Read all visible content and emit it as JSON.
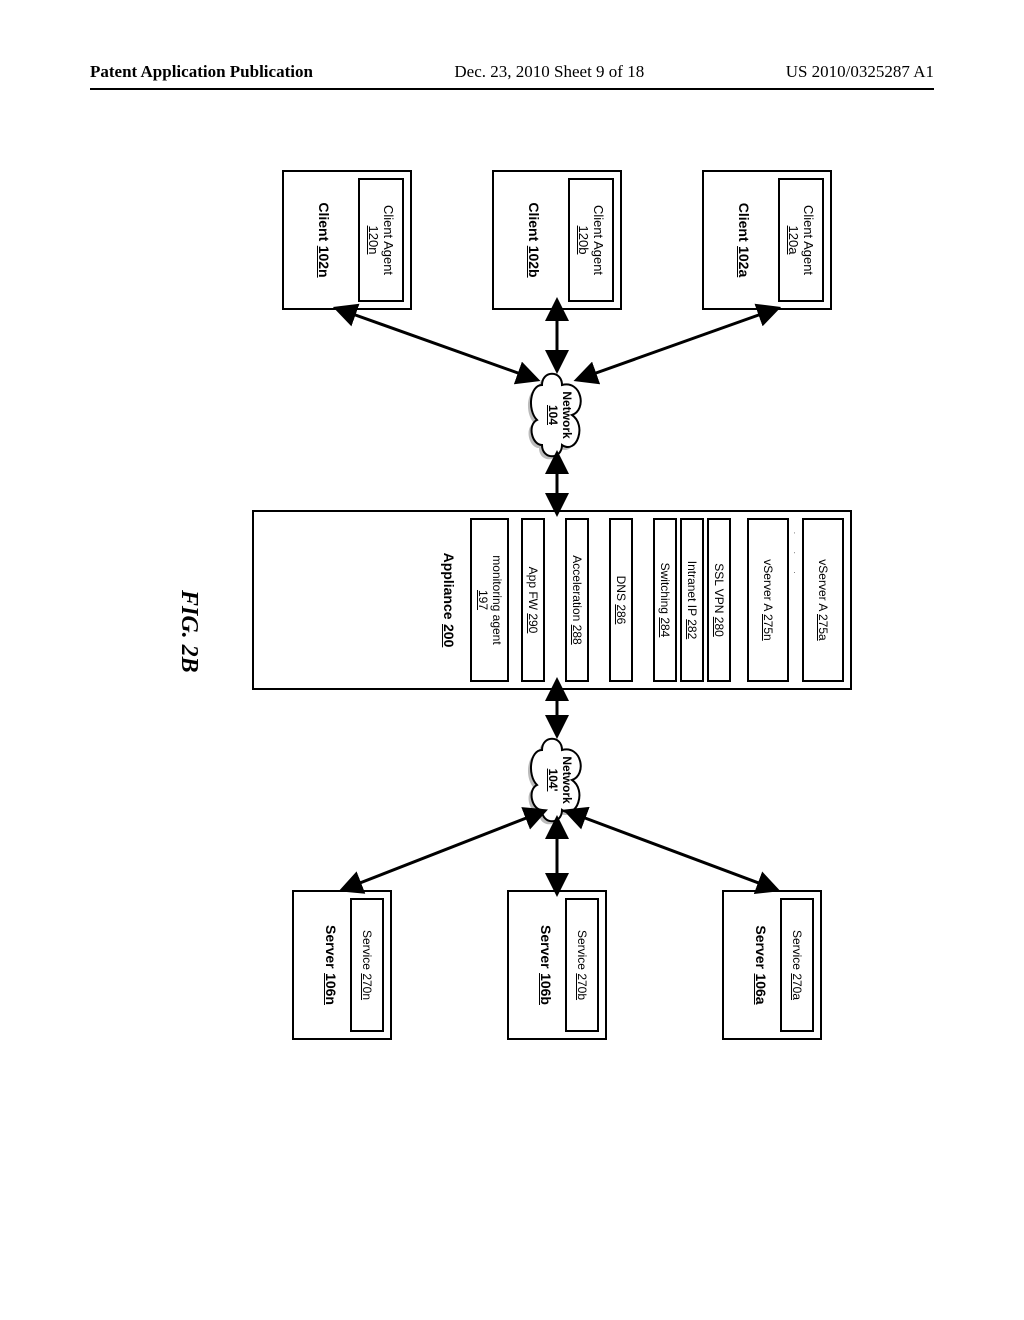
{
  "header": {
    "left": "Patent Application Publication",
    "center": "Dec. 23, 2010  Sheet 9 of 18",
    "right": "US 2010/0325287 A1"
  },
  "clients": [
    {
      "label": "Client",
      "ref": "102a",
      "agent_label": "Client Agent",
      "agent_ref": "120a"
    },
    {
      "label": "Client",
      "ref": "102b",
      "agent_label": "Client Agent",
      "agent_ref": "120b"
    },
    {
      "label": "Client",
      "ref": "102n",
      "agent_label": "Client Agent",
      "agent_ref": "120n"
    }
  ],
  "net1": {
    "label": "Network",
    "ref": "104"
  },
  "net2": {
    "label": "Network",
    "ref": "104'"
  },
  "appliance": {
    "label": "Appliance",
    "ref": "200",
    "v1_label": "vServer A",
    "v1_ref": "275a",
    "vn_label": "vServer A",
    "vn_ref": "275n",
    "rows": [
      {
        "label": "SSL VPN",
        "ref": "280"
      },
      {
        "label": "Intranet IP",
        "ref": "282"
      },
      {
        "label": "Switching",
        "ref": "284"
      },
      {
        "label": "DNS",
        "ref": "286"
      },
      {
        "label": "Acceleration",
        "ref": "288"
      },
      {
        "label": "App FW",
        "ref": "290"
      },
      {
        "label_multi": "monitoring agent",
        "ref": "197"
      }
    ]
  },
  "servers": [
    {
      "label": "Server",
      "ref": "106a",
      "svc_label": "Service",
      "svc_ref": "270a"
    },
    {
      "label": "Server",
      "ref": "106b",
      "svc_label": "Service",
      "svc_ref": "270b"
    },
    {
      "label": "Server",
      "ref": "106n",
      "svc_label": "Service",
      "svc_ref": "270n"
    }
  ],
  "figcap": "FIG. 2B"
}
